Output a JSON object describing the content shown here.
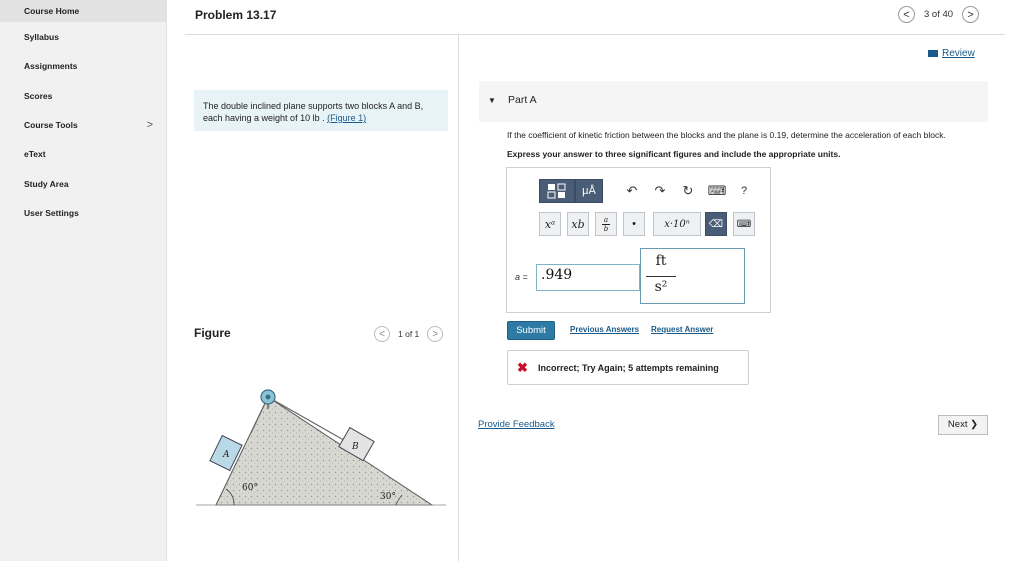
{
  "sidebar": {
    "items": [
      {
        "label": "Course Home",
        "active": true
      },
      {
        "label": "Syllabus"
      },
      {
        "label": "Assignments"
      },
      {
        "label": "Scores"
      },
      {
        "label": "Course Tools",
        "has_submenu": true
      },
      {
        "label": "eText"
      },
      {
        "label": "Study Area"
      },
      {
        "label": "User Settings"
      }
    ],
    "submenu_chevron": ">"
  },
  "header": {
    "title": "Problem 13.17",
    "page_indicator": "3 of 40",
    "prev_glyph": "<",
    "next_glyph": ">"
  },
  "review_link": "Review",
  "problem": {
    "text": "The double inclined plane supports two blocks A and B, each having a weight of 10 lb . ",
    "figure_link": "(Figure 1)"
  },
  "figure_section": {
    "title": "Figure",
    "page_indicator": "1 of 1",
    "labels": {
      "block_a": "A",
      "block_b": "B",
      "angle_left": "60°",
      "angle_right": "30°"
    }
  },
  "part": {
    "label": "Part A",
    "question": "If the coefficient of kinetic friction between the blocks and the plane is 0.19, determine the acceleration of each block.",
    "instructions": "Express your answer to three significant figures and include the appropriate units."
  },
  "toolbar": {
    "units_btn": "μÅ",
    "help_btn": "?",
    "superscript_btn": "xᵃ",
    "subscript_btn": "xb",
    "fraction_top": "a",
    "fraction_bottom": "b",
    "dot_btn": "•",
    "sci_btn": "x·10ⁿ",
    "delete_btn": "⌫",
    "keyboard_btn": "⌨"
  },
  "answer": {
    "label": "a =",
    "value": ".949",
    "unit_numerator": "ft",
    "unit_denominator": "s²"
  },
  "actions": {
    "submit": "Submit",
    "previous_answers": "Previous Answers",
    "request_answer": "Request Answer"
  },
  "feedback": {
    "message": "Incorrect; Try Again; 5 attempts remaining"
  },
  "provide_feedback": "Provide Feedback",
  "next_button": "Next ❯",
  "colors": {
    "accent": "#2d7aa5",
    "link": "#1a5a8a",
    "error": "#c8102e",
    "toolbar_dark": "#4a5d76"
  }
}
